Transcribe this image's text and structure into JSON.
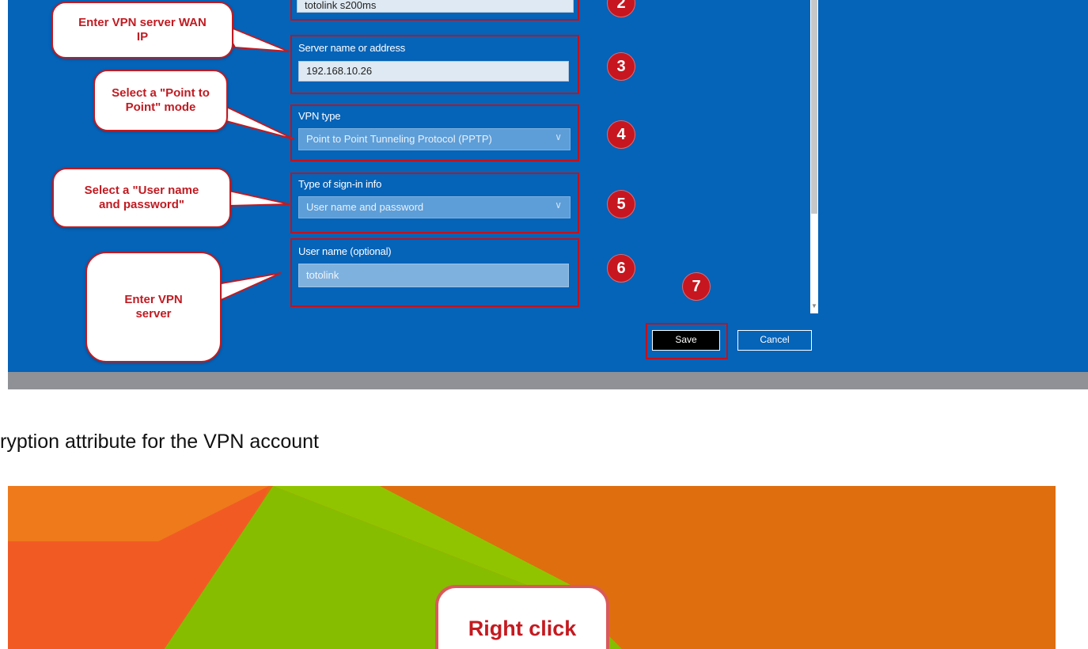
{
  "vpn_dialog": {
    "connection_name_value": "totolink s200ms",
    "server_label": "Server name or address",
    "server_value": "192.168.10.26",
    "vpn_type_label": "VPN type",
    "vpn_type_value": "Point to Point Tunneling Protocol (PPTP)",
    "signin_label": "Type of sign-in info",
    "signin_value": "User name and password",
    "username_label": "User name (optional)",
    "username_value": "totolink",
    "save_label": "Save",
    "cancel_label": "Cancel"
  },
  "callouts": {
    "wan_ip": "Enter VPN server WAN IP",
    "point_mode": "Select a \"Point to Point\" mode",
    "user_pass": "Select a \"User name and password\"",
    "enter_server": "Enter VPN server"
  },
  "steps": [
    "2",
    "3",
    "4",
    "5",
    "6",
    "7"
  ],
  "caption": "ryption attribute for the VPN account",
  "desktop": {
    "right_click": "Right click"
  },
  "colors": {
    "dialog_blue": "#0563b8",
    "annotation_red": "#c01b22",
    "desktop_orange": "#df6e0f",
    "desktop_green": "#86bd00"
  }
}
